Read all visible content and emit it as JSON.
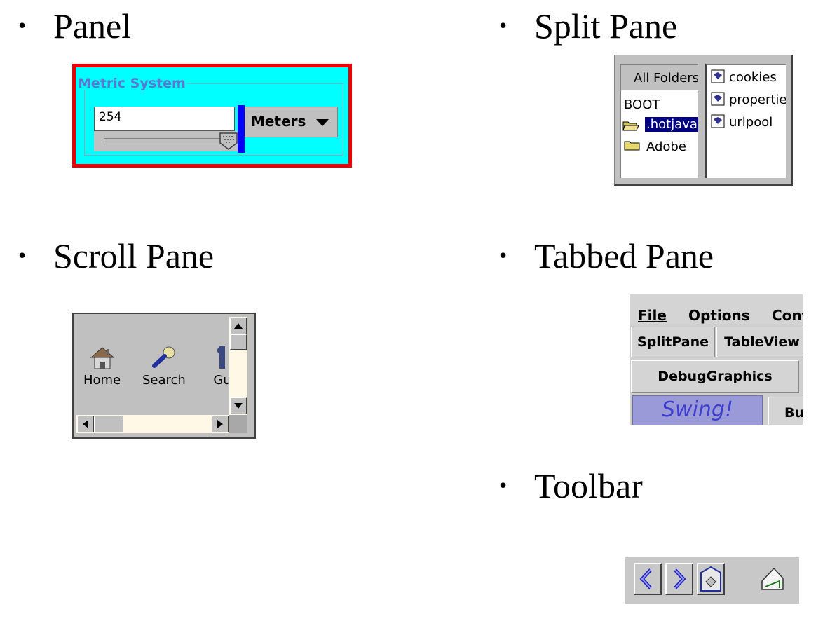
{
  "headings": {
    "bullet": "•",
    "panel": "Panel",
    "split_pane": "Split Pane",
    "scroll_pane": "Scroll Pane",
    "tabbed_pane": "Tabbed Pane",
    "toolbar": "Toolbar"
  },
  "panel": {
    "legend": "Metric System",
    "input_value": "254",
    "select_value": "Meters",
    "colors": {
      "border": "#ee0000",
      "background": "#00ffff",
      "divider": "#0000ff",
      "legend": "#5b78d0"
    }
  },
  "split_pane": {
    "header": "All Folders",
    "folders": [
      {
        "label": "BOOT",
        "icon": "none"
      },
      {
        "label": ".hotjava",
        "icon": "open-folder-icon",
        "selected": true
      },
      {
        "label": "Adobe",
        "icon": "folder-icon"
      }
    ],
    "files": [
      {
        "label": "cookies",
        "icon": "file-icon"
      },
      {
        "label": "propertie",
        "icon": "file-icon"
      },
      {
        "label": "urlpool",
        "icon": "file-icon"
      }
    ]
  },
  "scroll_pane": {
    "tools": [
      {
        "label": "Home",
        "icon": "home-icon"
      },
      {
        "label": "Search",
        "icon": "search-icon"
      },
      {
        "label": "Gu",
        "icon": "guide-icon"
      }
    ]
  },
  "tabbed_pane": {
    "menus": [
      "File",
      "Options",
      "Cont"
    ],
    "tab_rows": [
      [
        "SplitPane",
        "TableView"
      ],
      [
        "DebugGraphics"
      ],
      [
        "Swing!",
        "Bu"
      ]
    ]
  },
  "toolbar": {
    "buttons": [
      "back-arrow-icon",
      "forward-arrow-icon",
      "home-page-icon",
      "bookmark-page-icon"
    ]
  }
}
